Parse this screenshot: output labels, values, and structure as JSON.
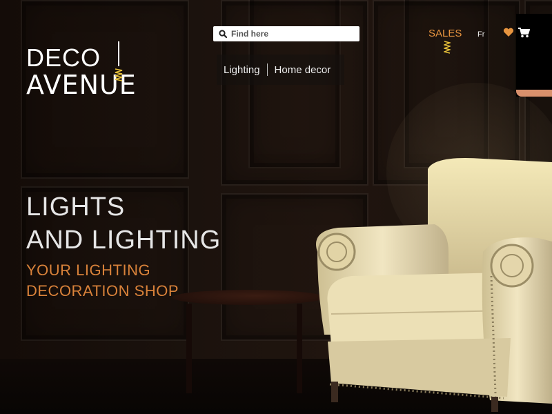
{
  "brand": {
    "line1": "DECO",
    "line2": "AVENUE"
  },
  "search": {
    "placeholder": "Find here",
    "value": ""
  },
  "nav": {
    "items": [
      {
        "label": "Lighting"
      },
      {
        "label": "Home decor"
      }
    ]
  },
  "topbar": {
    "sales_label": "SALES",
    "language": "Fr"
  },
  "icons": {
    "search": "search-icon",
    "wishlist": "heart-icon",
    "cart": "cart-icon",
    "logo_bulb": "bulb-icon"
  },
  "hero": {
    "title_line1": "LIGHTS",
    "title_line2": "AND LIGHTING",
    "subtitle_line1": "YOUR LIGHTING",
    "subtitle_line2": "DECORATION SHOP"
  },
  "colors": {
    "accent": "#e7943f",
    "bulb": "#e8c23a",
    "text_light": "#e6e6e6",
    "lamp_rim": "#d9906c"
  }
}
